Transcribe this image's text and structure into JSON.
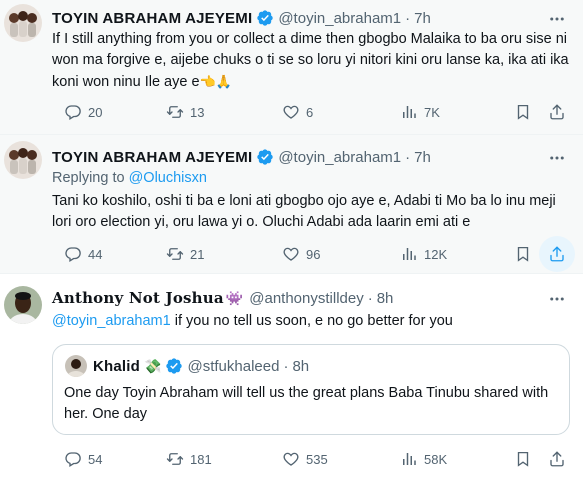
{
  "tweets": [
    {
      "name": "TOYIN ABRAHAM AJEYEMI",
      "handle": "@toyin_abraham1",
      "dot": "·",
      "time": "7h",
      "text": "If I still anything from you or collect a dime then gbogbo Malaika to ba oru sise ni won ma forgive e, aijebe chuks o ti se so loru yi nitori kini oru lanse ka, ika ati ika koni won ninu Ile aye e",
      "emoji": "👈🙏",
      "replies": "20",
      "reposts": "13",
      "likes": "6",
      "views": "7K"
    },
    {
      "name": "TOYIN ABRAHAM AJEYEMI",
      "handle": "@toyin_abraham1",
      "dot": "·",
      "time": "7h",
      "replying_prefix": "Replying to",
      "replying_to": "@Oluchisxn",
      "text": "Tani ko koshilo, oshi ti ba e loni ati gbogbo ojo aye e, Adabi ti Mo ba lo inu meji lori oro election yi, oru lawa yi o. Oluchi Adabi ada laarin emi ati e",
      "replies": "44",
      "reposts": "21",
      "likes": "96",
      "views": "12K"
    },
    {
      "name_part1": "Anthony",
      "name_part2": "Not",
      "name_part3": "Joshua",
      "name_emoji": "👾",
      "handle": "@anthonystilldey",
      "dot": "·",
      "time": "8h",
      "mention": "@toyin_abraham1",
      "text": " if you no tell us soon, e no go better for you",
      "quote": {
        "name": "Khalid",
        "name_emoji": "💸",
        "handle": "@stfukhaleed",
        "dot": "·",
        "time": "8h",
        "text": "One day Toyin Abraham will tell us the great plans Baba Tinubu shared with her. One day"
      },
      "replies": "54",
      "reposts": "181",
      "likes": "535",
      "views": "58K"
    }
  ],
  "colors": {
    "accent": "#1d9bf0",
    "muted": "#536471",
    "text": "#0f1419",
    "highlight_bg": "#f7f9f9"
  }
}
